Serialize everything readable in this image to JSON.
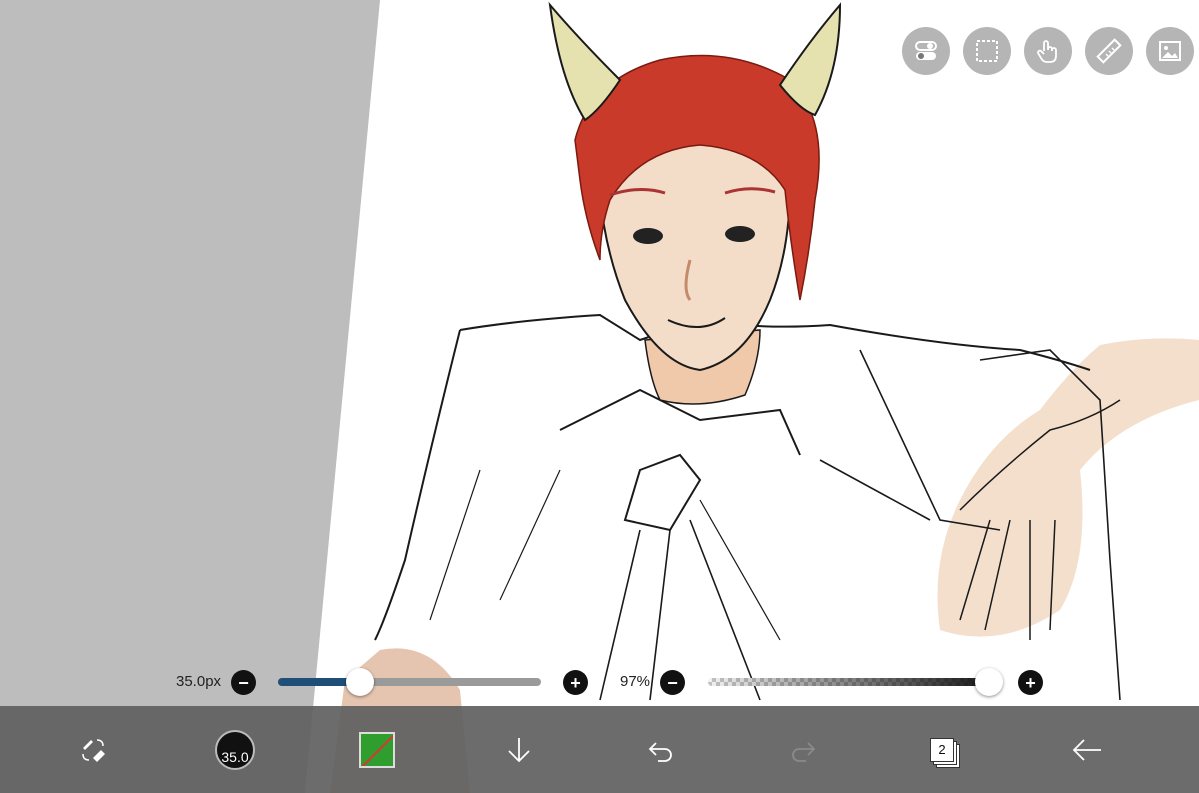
{
  "colors": {
    "outside_canvas": "#bdbdbd",
    "canvas": "#ffffff",
    "toolbar": "#5f5f5f",
    "brush_color": "#2f9e2f",
    "size_track_fill": "#1f4e79",
    "skin": "#f3dcc8",
    "hair": "#c93a2a",
    "ear_inner": "#e5e2b0"
  },
  "top_tools": [
    {
      "icon": "toggle-icon"
    },
    {
      "icon": "selection-icon"
    },
    {
      "icon": "hand-icon"
    },
    {
      "icon": "ruler-icon"
    },
    {
      "icon": "image-icon"
    }
  ],
  "brush_size_slider": {
    "label": "35.0px",
    "value_fraction": 0.31
  },
  "opacity_slider": {
    "label": "97%",
    "value_fraction": 0.97
  },
  "toolbar": {
    "brush_size_value": "35.0",
    "layer_count": "2",
    "items": [
      {
        "icon": "brush-eraser-swap-icon"
      },
      {
        "icon": "brush-size-icon"
      },
      {
        "icon": "color-swatch-icon"
      },
      {
        "icon": "arrow-down-icon"
      },
      {
        "icon": "undo-icon"
      },
      {
        "icon": "redo-icon"
      },
      {
        "icon": "layers-icon"
      },
      {
        "icon": "back-arrow-icon"
      }
    ]
  }
}
